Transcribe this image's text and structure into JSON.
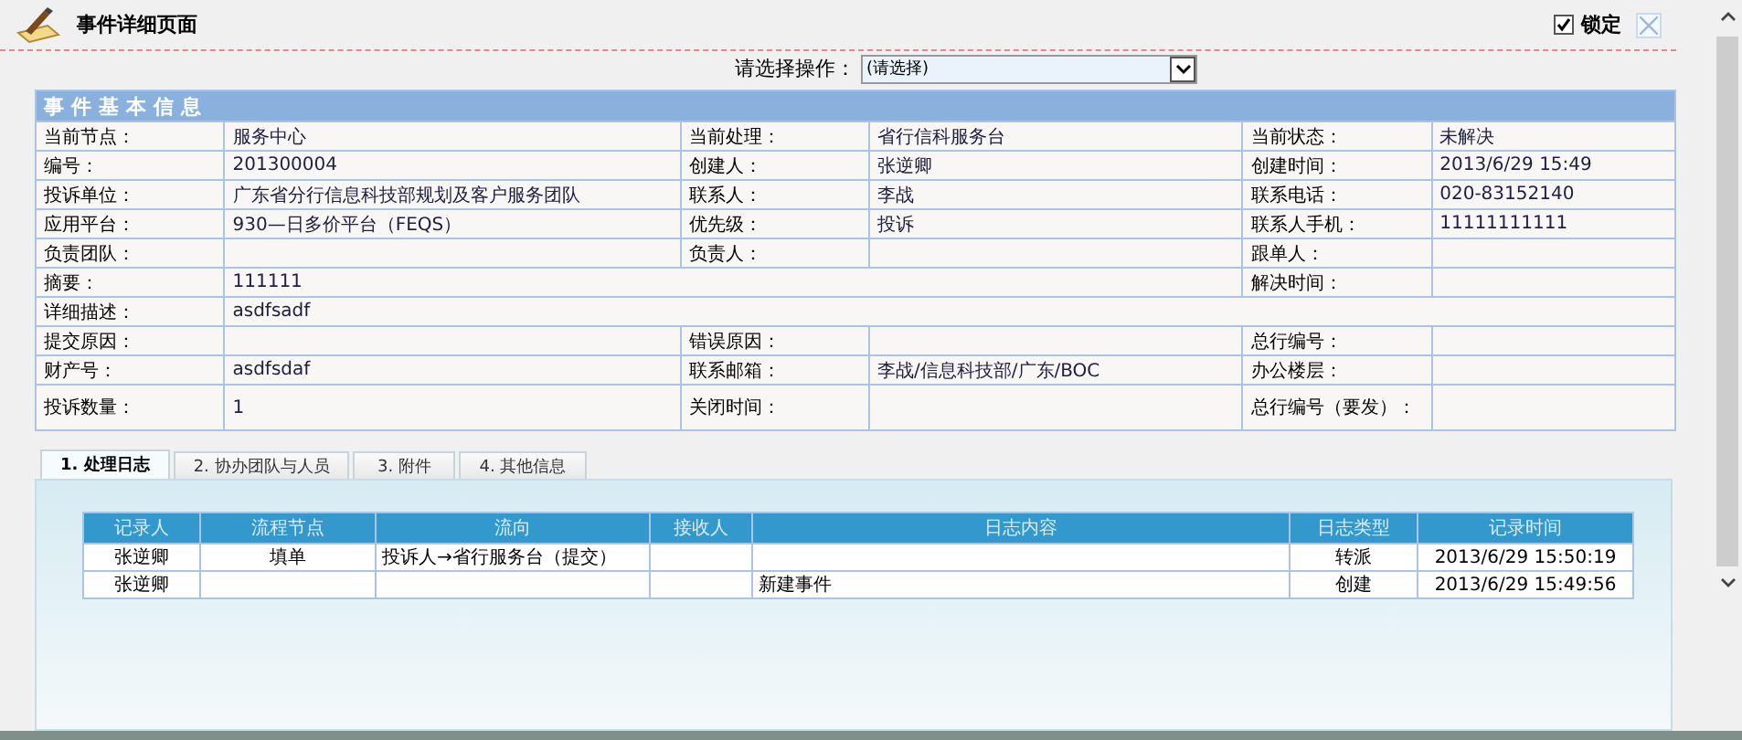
{
  "page": {
    "title": "事件详细页面",
    "lock": {
      "label": "锁定",
      "checked": true
    }
  },
  "operation": {
    "label": "请选择操作：",
    "value": "(请选择)"
  },
  "info": {
    "title": "事件基本信息",
    "rows": [
      [
        "当前节点：",
        "服务中心",
        "当前处理：",
        "省行信科服务台",
        "当前状态：",
        "未解决"
      ],
      [
        "编号：",
        "201300004",
        "创建人：",
        "张逆卿",
        "创建时间：",
        "2013/6/29 15:49"
      ],
      [
        "投诉单位：",
        "广东省分行信息科技部规划及客户服务团队",
        "联系人：",
        "李战",
        "联系电话：",
        "020-83152140"
      ],
      [
        "应用平台：",
        "930—日多价平台（FEQS）",
        "优先级：",
        "投诉",
        "联系人手机：",
        "11111111111"
      ],
      [
        "负责团队：",
        "",
        "负责人：",
        "",
        "跟单人：",
        ""
      ],
      [
        "摘要：",
        {
          "text": "111111",
          "colspan": 3
        },
        "解决时间：",
        ""
      ],
      [
        "详细描述：",
        {
          "text": "asdfsadf",
          "colspan": 5
        }
      ],
      [
        "提交原因：",
        "",
        "错误原因：",
        "",
        "总行编号：",
        ""
      ],
      [
        "财产号：",
        "asdfsdaf",
        "联系邮箱：",
        "李战/信息科技部/广东/BOC",
        "办公楼层：",
        ""
      ],
      [
        "投诉数量：",
        "1",
        "关闭时间：",
        "",
        "总行编号（要发）：",
        ""
      ]
    ]
  },
  "tabs": [
    {
      "label": "1. 处理日志",
      "selected": true
    },
    {
      "label": "2. 协办团队与人员",
      "selected": false
    },
    {
      "label": "3. 附件",
      "selected": false
    },
    {
      "label": "4. 其他信息",
      "selected": false
    }
  ],
  "log": {
    "columns": [
      "记录人",
      "流程节点",
      "流向",
      "接收人",
      "日志内容",
      "日志类型",
      "记录时间"
    ],
    "rows": [
      [
        "张逆卿",
        "填单",
        "投诉人→省行服务台（提交）",
        "",
        "",
        "转派",
        "2013/6/29 15:50:19"
      ],
      [
        "张逆卿",
        "",
        "",
        "",
        "新建事件",
        "创建",
        "2013/6/29 15:49:56"
      ]
    ]
  }
}
